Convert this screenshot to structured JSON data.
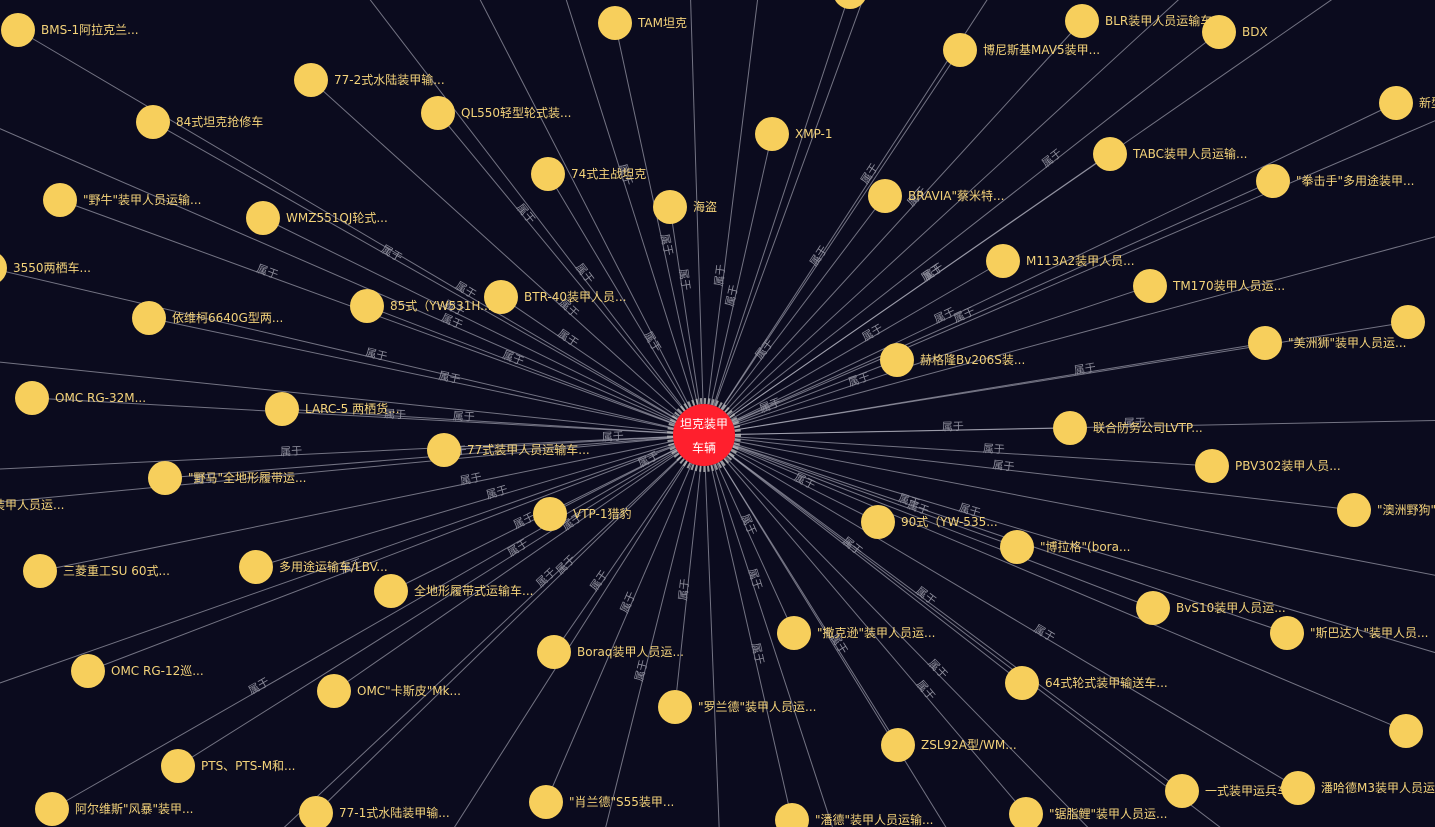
{
  "graph": {
    "center": {
      "label_line1": "坦克装甲",
      "label_line2": "车辆",
      "color": "#ff1f2d"
    },
    "edge_label": "属于",
    "node_color": "#f7cf5c",
    "label_color": "#f4d37a",
    "background": "#0b0b1e",
    "nodes": [
      "BMS-1阿拉克兰...",
      "TAM坦克",
      "BLR装甲人员运输车",
      "BDX",
      "77-2式水陆装甲输...",
      "博尼斯基MAV5装甲...",
      "84式坦克抢修车",
      "QL550轻型轮式装...",
      "新型",
      "XMP-1",
      "TABC装甲人员运输...",
      "\"野牛\"装甲人员运输...",
      "74式主战坦克",
      "\"拳击手\"多用途装甲...",
      "WMZ551QJ轮式...",
      "海盗",
      "BRAVIA\"蔡米特...",
      "3550两栖车...",
      "M113A2装甲人员...",
      "BTR-40装甲人员...",
      "TM170装甲人员运...",
      "依维柯6640G型两...",
      "85式（YW531H...",
      "\"美洲狮\"装甲人员运...",
      "赫格隆Bv206S装...",
      "OMC RG-32M...",
      "LARC-5 两栖货...",
      "联合防务公司LVTP...",
      "77式装甲人员运输车...",
      "\"野马\"全地形履带运...",
      "PBV302装甲人员...",
      "装甲人员运...",
      "VTP-1猎豹",
      "\"澳洲野狗\"",
      "90式（YW-535...",
      "\"博拉格\"(bora...",
      "三菱重工SU 60式...",
      "多用途运输车/LBV...",
      "全地形履带式运输车...",
      "BvS10装甲人员运...",
      "\"斯巴达人\"装甲人员...",
      "\"撒克逊\"装甲人员运...",
      "OMC RG-12巡...",
      "Boraq装甲人员运...",
      "OMC\"卡斯皮\"Mk...",
      "64式轮式装甲输送车...",
      "\"罗兰德\"装甲人员运...",
      "ZSL92A型/WM...",
      "PTS、PTS-M和...",
      "一式装甲运兵车",
      "潘哈德M3装甲人员运...",
      "阿尔维斯\"风暴\"装甲...",
      "77-1式水陆装甲输...",
      "\"肖兰德\"S55装甲...",
      "\"潘德\"装甲人员运输...",
      "\"锯脂鲤\"装甲人员运..."
    ]
  }
}
